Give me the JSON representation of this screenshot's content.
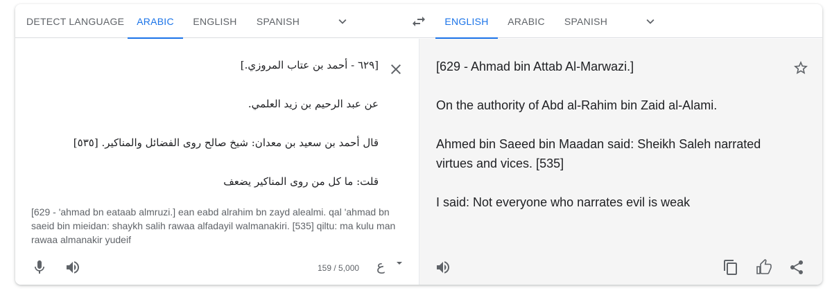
{
  "source_langs": {
    "tabs": [
      {
        "label": "DETECT LANGUAGE",
        "active": false
      },
      {
        "label": "ARABIC",
        "active": true
      },
      {
        "label": "ENGLISH",
        "active": false
      },
      {
        "label": "SPANISH",
        "active": false
      }
    ]
  },
  "target_langs": {
    "tabs": [
      {
        "label": "ENGLISH",
        "active": true
      },
      {
        "label": "ARABIC",
        "active": false
      },
      {
        "label": "SPANISH",
        "active": false
      }
    ]
  },
  "source": {
    "lines": [
      "[٦٢٩ - أحمد بن عتاب المروزي.]",
      "عن عبد الرحيم بن زيد العلمي.",
      "قال أحمد بن سعيد بن معدان: شيخ صالح روى الفضائل والمناكير. [٥٣٥]",
      "قلت: ما كل من روى المناكير يضعف"
    ],
    "transliteration": "[629 - 'ahmad bn eataab almruzi.] ean eabd alrahim bn zayd alealmi. qal 'ahmad bn saeid bin mieidan: shaykh salih rawaa alfadayil walmanakiri. [535] qiltu: ma kulu man rawaa almanakir yudeif",
    "char_count": "159 / 5,000",
    "keyboard_label": "ع"
  },
  "target": {
    "paragraphs": [
      "[629 - Ahmad bin Attab Al-Marwazi.]",
      "On the authority of Abd al-Rahim bin Zaid al-Alami.",
      "Ahmed bin Saeed bin Maadan said: Sheikh Saleh narrated virtues and vices. [535]",
      "I said: Not everyone who narrates evil is weak"
    ]
  },
  "colors": {
    "accent": "#1a73e8",
    "icon": "#5f6368",
    "target_bg": "#f5f5f5"
  }
}
